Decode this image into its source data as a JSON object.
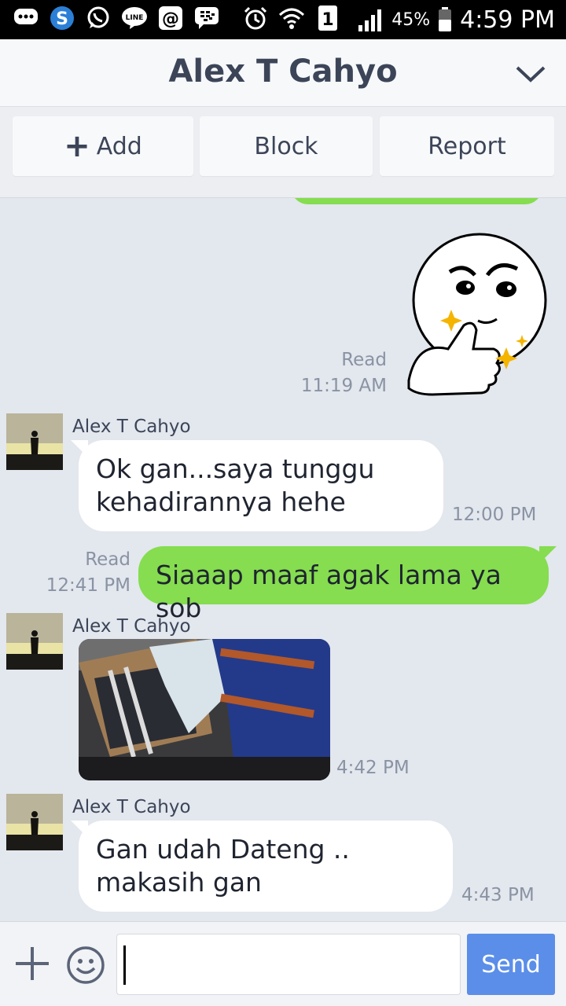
{
  "status_bar": {
    "icons": [
      "message-icon",
      "skype-icon",
      "whatsapp-icon",
      "line-icon",
      "email-icon",
      "bbm-icon",
      "alarm-icon",
      "wifi-icon",
      "sim-icon",
      "signal-icon",
      "battery-icon"
    ],
    "sim_slot": "1",
    "battery": "45%",
    "time": "4:59 PM"
  },
  "header": {
    "title": "Alex T Cahyo",
    "dropdown_icon": "chevron-down-icon"
  },
  "actions": {
    "add_icon": "plus-icon",
    "add": "Add",
    "block": "Block",
    "report": "Report"
  },
  "chat": {
    "messages": [
      {
        "type": "sticker",
        "direction": "out",
        "read": "Read",
        "time": "11:19 AM"
      },
      {
        "type": "text",
        "direction": "in",
        "sender": "Alex T Cahyo",
        "lines": [
          "Ok gan...saya tunggu",
          "kehadirannya hehe"
        ],
        "time": "12:00 PM"
      },
      {
        "type": "text",
        "direction": "out",
        "read": "Read",
        "lines": [
          "Siaaap maaf agak lama ya sob"
        ],
        "time": "12:41 PM"
      },
      {
        "type": "photo",
        "direction": "in",
        "sender": "Alex T Cahyo",
        "time": "4:42 PM"
      },
      {
        "type": "text",
        "direction": "in",
        "sender": "Alex T Cahyo",
        "lines": [
          "Gan udah Dateng ..",
          "makasih gan"
        ],
        "time": "4:43 PM"
      }
    ]
  },
  "input": {
    "placeholder": "",
    "send": "Send",
    "icons": [
      "plus-icon",
      "emoji-icon"
    ]
  },
  "colors": {
    "outgoing_bubble": "#85dd4f",
    "incoming_bubble": "#ffffff",
    "chat_background": "#e3e7ee",
    "send_button": "#5b8ee8",
    "title_text": "#3c4558"
  }
}
